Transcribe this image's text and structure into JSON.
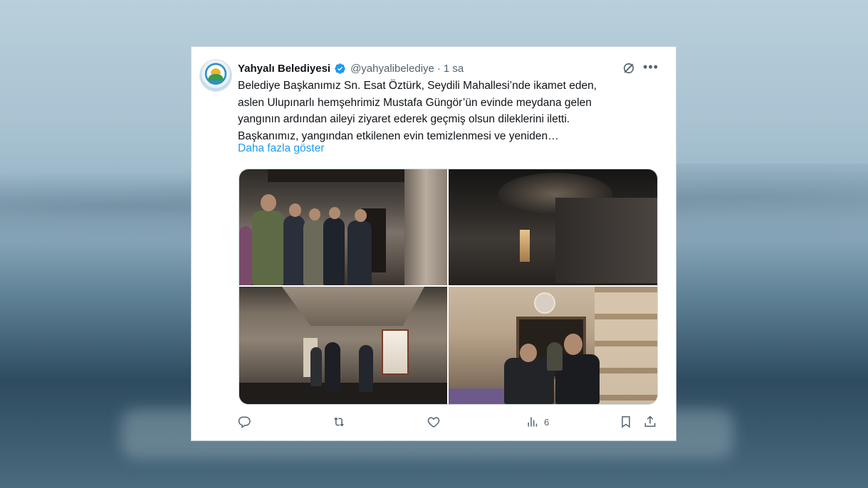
{
  "tweet": {
    "author_name": "Yahyalı Belediyesi",
    "handle": "@yahyalibelediye",
    "separator": "·",
    "time": "1 sa",
    "text_lines": [
      "Belediye Başkanımız Sn. Esat Öztürk, Seydili Mahallesi’nde ikamet eden,",
      "aslen Ulupınarlı hemşehrimiz Mustafa Güngör’ün evinde meydana gelen",
      "yangının ardından aileyi ziyaret ederek geçmiş olsun dileklerini iletti.",
      "Başkanımız, yangından etkilenen evin temizlenmesi ve yeniden…"
    ],
    "show_more": "Daha fazla göster",
    "views": "6"
  },
  "icons": {
    "verified": "verified-badge-icon",
    "grok": "grok-icon",
    "more": "more-icon",
    "reply": "reply-icon",
    "retweet": "retweet-icon",
    "like": "like-icon",
    "views": "views-icon",
    "bookmark": "bookmark-icon",
    "share": "share-icon"
  },
  "colors": {
    "accent": "#1d9bf0",
    "text": "#0f1419",
    "secondary": "#536471"
  }
}
